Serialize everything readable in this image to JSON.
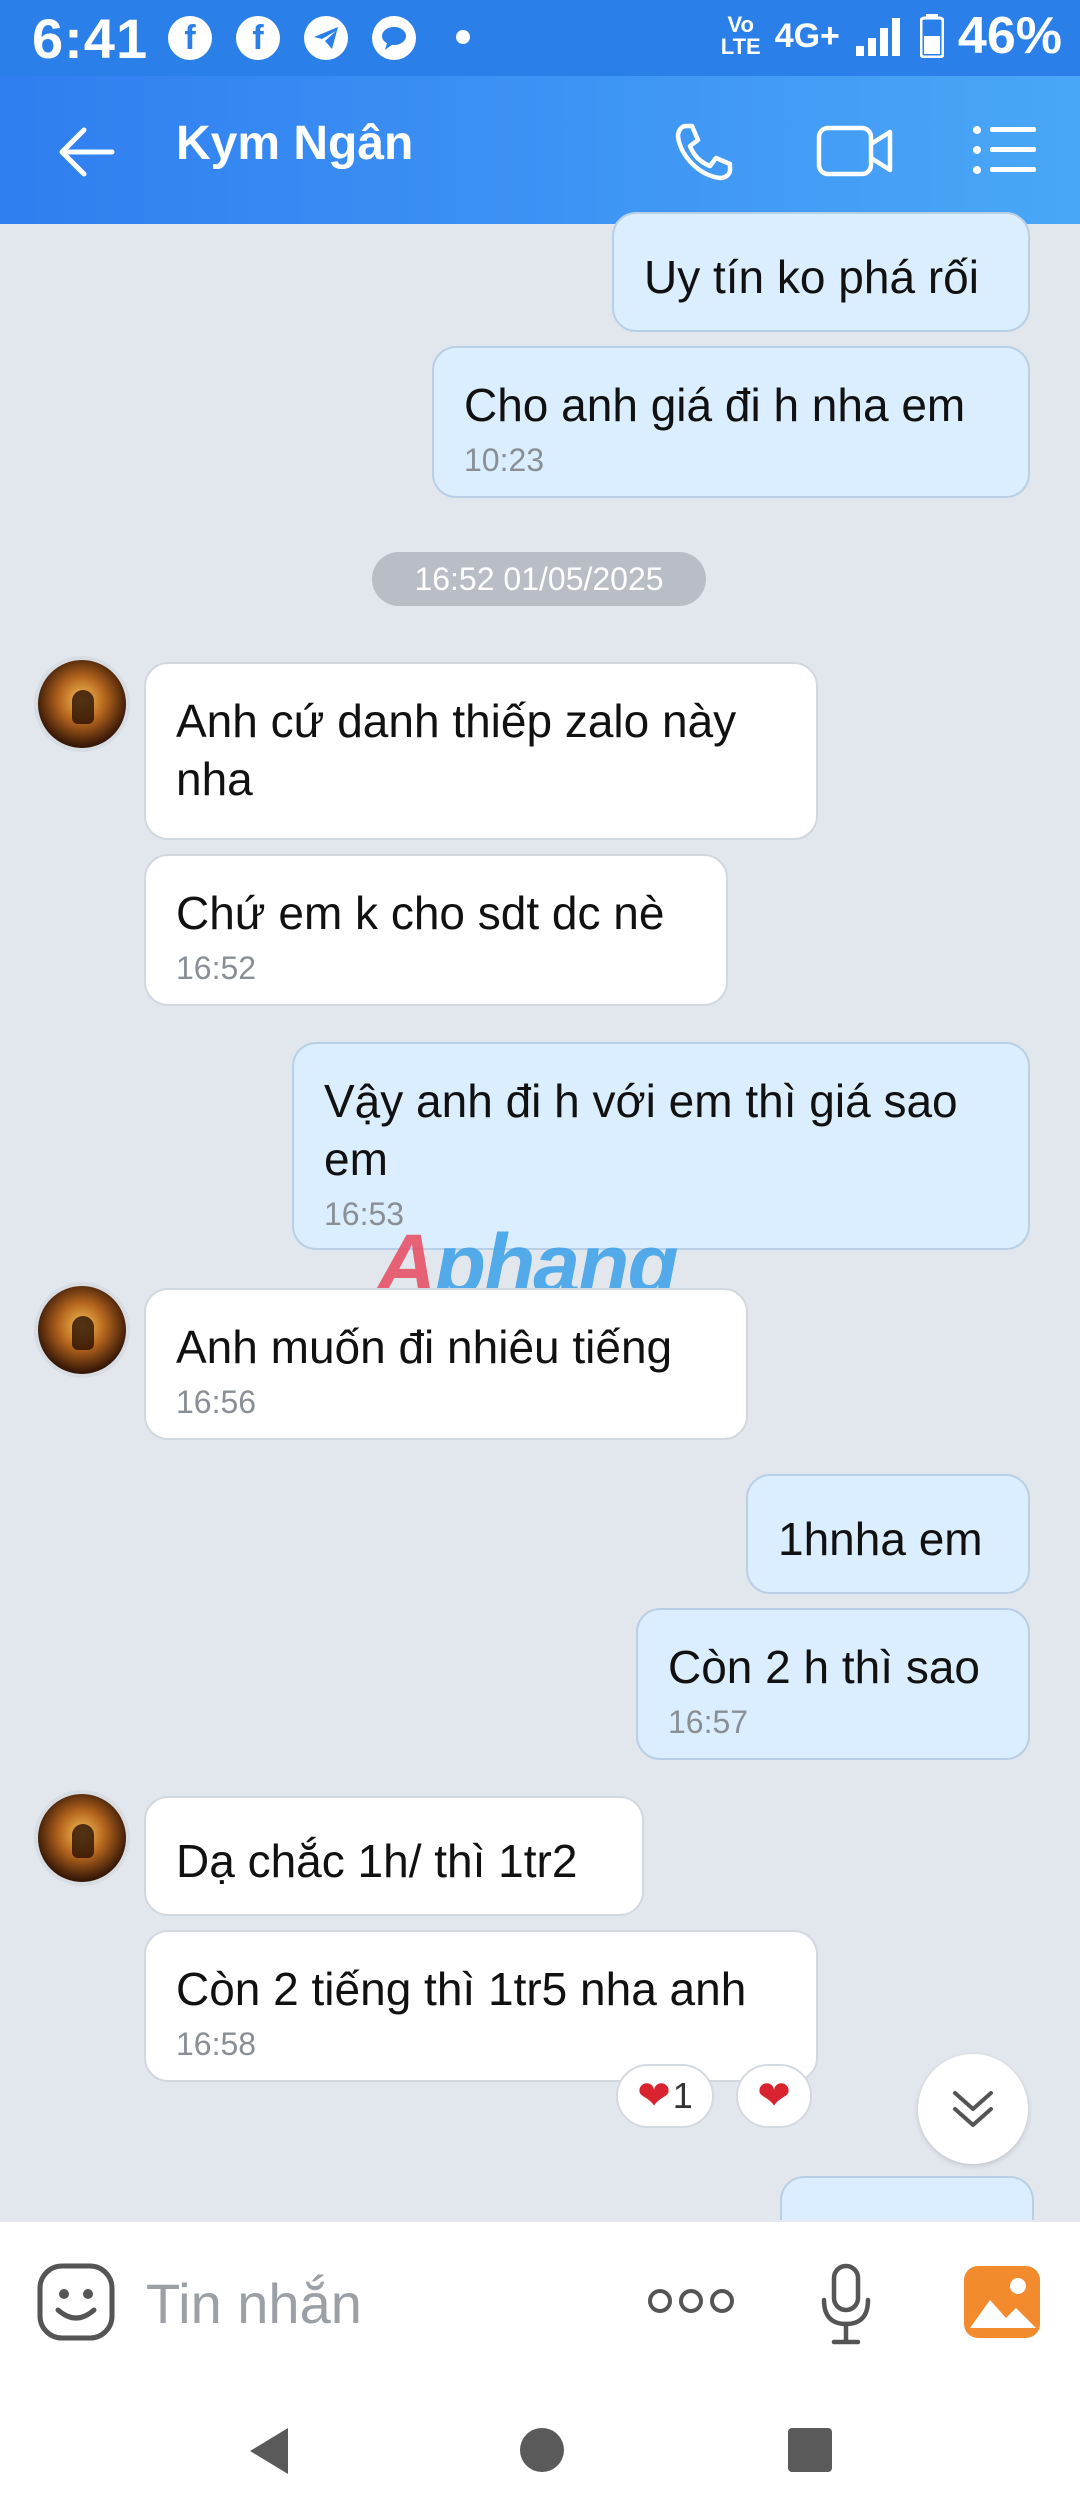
{
  "status_bar": {
    "time": "6:41",
    "notifications": [
      "facebook-icon",
      "facebook-icon",
      "telegram-icon",
      "chat-icon"
    ],
    "volte_top": "Vo",
    "volte_bottom": "LTE",
    "network": "4G+",
    "battery": "46%"
  },
  "header": {
    "title": "Kym Ngân",
    "colors": {
      "start": "#2f7ef0",
      "end": "#4aa7f7"
    }
  },
  "messages": [
    {
      "dir": "out",
      "text": "Uy tín ko phá rối",
      "time": ""
    },
    {
      "dir": "out",
      "text": "Cho anh giá đi h nha em",
      "time": "10:23"
    },
    {
      "dir": "in",
      "text": "Anh cứ danh thiếp zalo này nha",
      "time": ""
    },
    {
      "dir": "in",
      "text": "Chứ em k cho sdt dc nè",
      "time": "16:52"
    },
    {
      "dir": "out",
      "text": "Vậy anh đi h với em thì giá sao em",
      "time": "16:53"
    },
    {
      "dir": "in",
      "text": "Anh muốn đi nhiêu tiếng",
      "time": "16:56"
    },
    {
      "dir": "out",
      "text": "1hnha em",
      "time": ""
    },
    {
      "dir": "out",
      "text": "Còn 2 h thì sao",
      "time": "16:57"
    },
    {
      "dir": "in",
      "text": "Dạ chắc 1h/ thì 1tr2",
      "time": ""
    },
    {
      "dir": "in",
      "text": "Còn 2 tiếng thì 1tr5 nha anh",
      "time": "16:58"
    }
  ],
  "date_separator": "16:52 01/05/2025",
  "watermark": {
    "part1": "A",
    "part2": "phang"
  },
  "reactions": {
    "count": "1"
  },
  "input": {
    "placeholder": "Tin nhắn"
  }
}
